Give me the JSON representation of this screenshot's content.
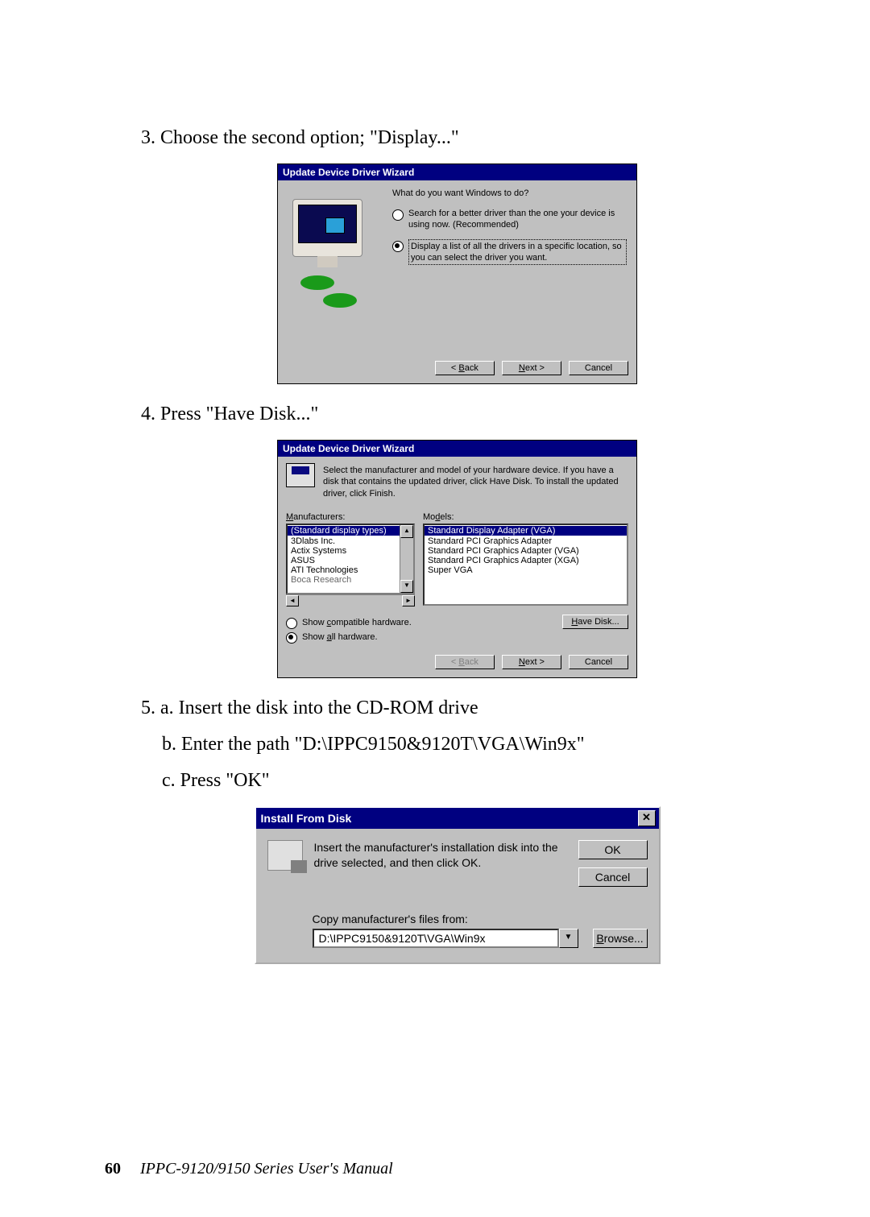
{
  "steps": {
    "s3": "3. Choose the second option; \"Display...\"",
    "s4": "4. Press \"Have Disk...\"",
    "s5a": "5. a. Insert the disk into the CD-ROM drive",
    "s5b": "b. Enter the path \"D:\\IPPC9150&9120T\\VGA\\Win9x\"",
    "s5c": "c. Press \"OK\""
  },
  "dlg1": {
    "title": "Update Device Driver Wizard",
    "question": "What do you want Windows to do?",
    "opt1": "Search for a better driver than the one your device is using now. (Recommended)",
    "opt2": "Display a list of all the drivers in a specific location, so you can select the driver you want.",
    "back": "< Back",
    "next": "Next >",
    "cancel": "Cancel"
  },
  "dlg2": {
    "title": "Update Device Driver Wizard",
    "intro": "Select the manufacturer and model of your hardware device. If you have a disk that contains the updated driver, click Have Disk. To install the updated driver, click Finish.",
    "mLabel": "Manufacturers:",
    "modLabel": "Models:",
    "mfrs": {
      "m0": "(Standard display types)",
      "m1": "3Dlabs Inc.",
      "m2": "Actix Systems",
      "m3": "ASUS",
      "m4": "ATI Technologies",
      "m5": "Boca Research"
    },
    "models": {
      "x0": "Standard Display Adapter (VGA)",
      "x1": "Standard PCI Graphics Adapter",
      "x2": "Standard PCI Graphics Adapter (VGA)",
      "x3": "Standard PCI Graphics Adapter (XGA)",
      "x4": "Super VGA"
    },
    "rCompat": "Show compatible hardware.",
    "rAll": "Show all hardware.",
    "have": "Have Disk...",
    "back": "< Back",
    "next": "Next >",
    "cancel": "Cancel"
  },
  "dlg3": {
    "title": "Install From Disk",
    "msg": "Insert the manufacturer's installation disk into the drive selected, and then click OK.",
    "ok": "OK",
    "cancel": "Cancel",
    "copy": "Copy manufacturer's files from:",
    "path": "D:\\IPPC9150&9120T\\VGA\\Win9x",
    "browse": "Browse..."
  },
  "footer": {
    "page": "60",
    "title": "IPPC-9120/9150 Series User's Manual"
  }
}
